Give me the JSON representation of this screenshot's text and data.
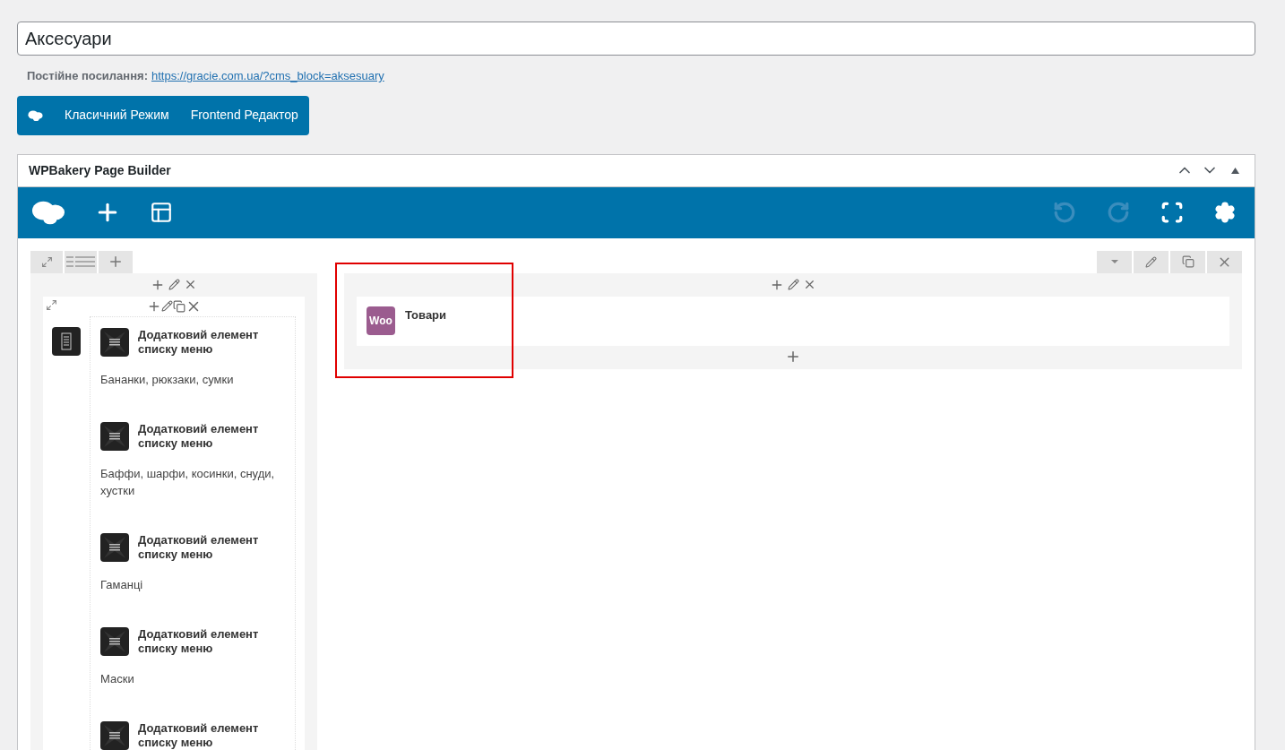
{
  "title_field": {
    "value": "Аксесуари"
  },
  "permalink": {
    "label": "Постійне посилання:",
    "url": "https://gracie.com.ua/?cms_block=aksesuary"
  },
  "editor_modes": [
    "Класичний Режим",
    "Frontend Редактор"
  ],
  "builder": {
    "title": "WPBakery Page Builder",
    "toolbar_left": [
      {
        "kind": "logo"
      },
      {
        "kind": "add"
      },
      {
        "kind": "templates"
      }
    ],
    "toolbar_right": [
      {
        "kind": "undo",
        "disabled": true
      },
      {
        "kind": "redo",
        "disabled": true
      },
      {
        "kind": "fullscreen",
        "disabled": false
      },
      {
        "kind": "settings",
        "disabled": false
      }
    ],
    "left_column": {
      "items": [
        {
          "title": "Додатковий елемент списку меню",
          "description": "Бананки, рюкзаки, сумки"
        },
        {
          "title": "Додатковий елемент списку меню",
          "description": "Баффи, шарфи, косинки, снуди, хустки"
        },
        {
          "title": "Додатковий елемент списку меню",
          "description": "Гаманці"
        },
        {
          "title": "Додатковий елемент списку меню",
          "description": "Маски"
        },
        {
          "title": "Додатковий елемент списку меню"
        }
      ]
    },
    "right_column": {
      "highlighted": true,
      "element": {
        "badge": "Woo",
        "title": "Товари"
      }
    }
  }
}
